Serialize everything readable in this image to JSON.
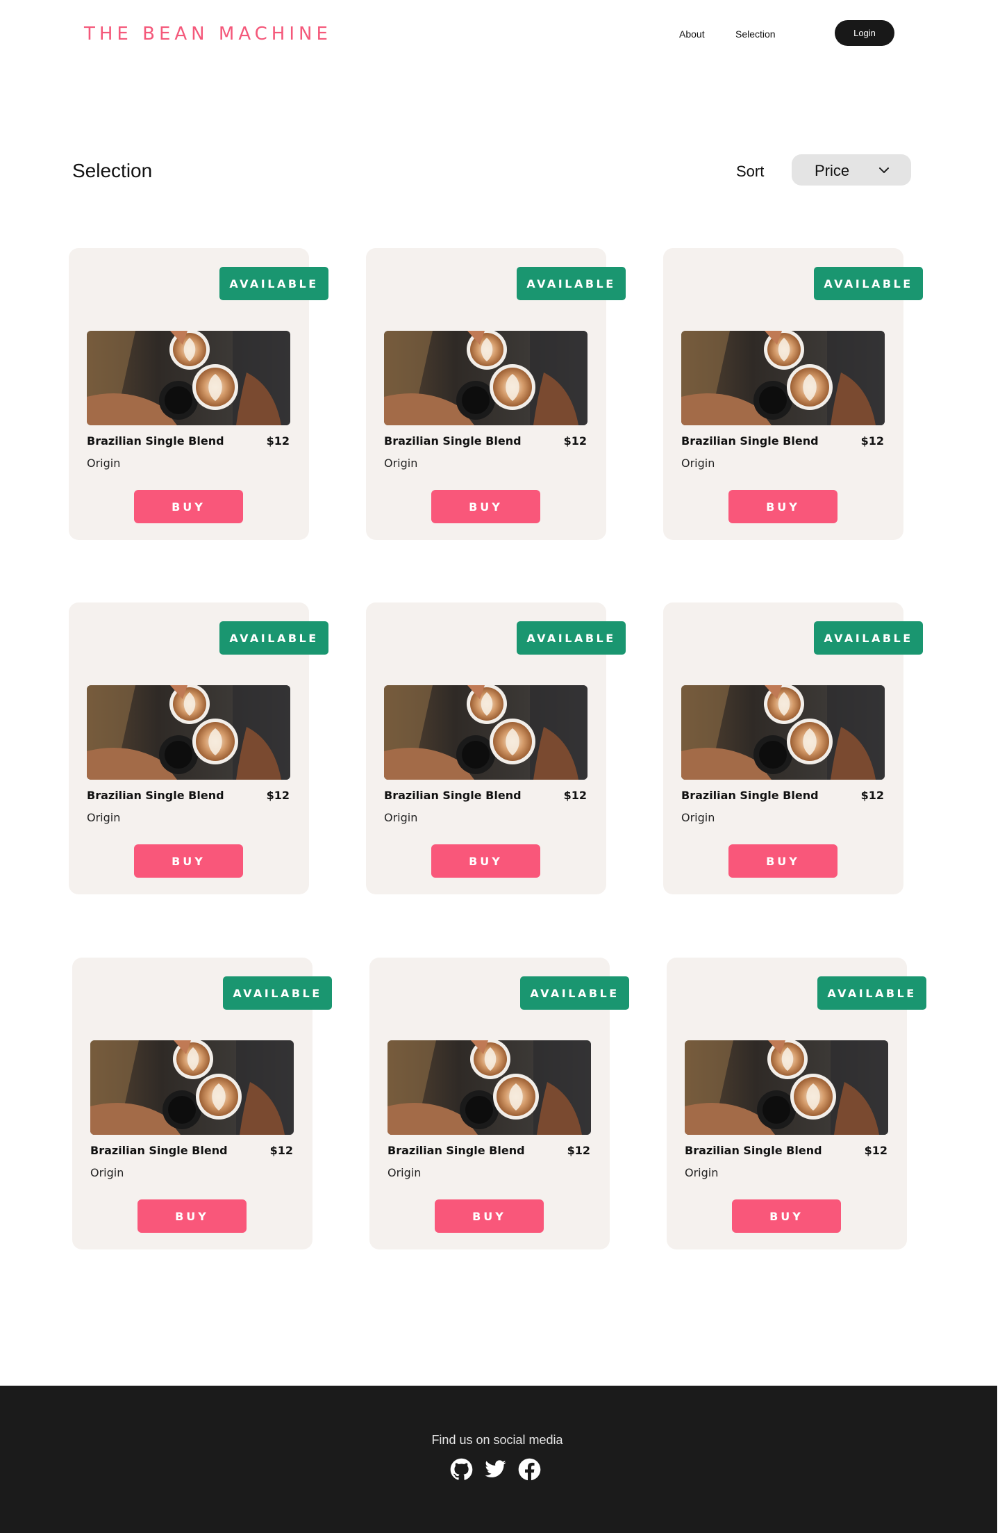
{
  "header": {
    "logo": "THE BEAN MACHINE",
    "nav": {
      "about": "About",
      "selection": "Selection"
    },
    "login_label": "Login"
  },
  "main": {
    "title": "Selection",
    "sort_label": "Sort",
    "sort_value": "Price"
  },
  "products": [
    {
      "status": "AVAILABLE",
      "name": "Brazilian Single Blend",
      "price": "$12",
      "origin": "Origin",
      "buy_label": "BUY"
    },
    {
      "status": "AVAILABLE",
      "name": "Brazilian Single Blend",
      "price": "$12",
      "origin": "Origin",
      "buy_label": "BUY"
    },
    {
      "status": "AVAILABLE",
      "name": "Brazilian Single Blend",
      "price": "$12",
      "origin": "Origin",
      "buy_label": "BUY"
    },
    {
      "status": "AVAILABLE",
      "name": "Brazilian Single Blend",
      "price": "$12",
      "origin": "Origin",
      "buy_label": "BUY"
    },
    {
      "status": "AVAILABLE",
      "name": "Brazilian Single Blend",
      "price": "$12",
      "origin": "Origin",
      "buy_label": "BUY"
    },
    {
      "status": "AVAILABLE",
      "name": "Brazilian Single Blend",
      "price": "$12",
      "origin": "Origin",
      "buy_label": "BUY"
    },
    {
      "status": "AVAILABLE",
      "name": "Brazilian Single Blend",
      "price": "$12",
      "origin": "Origin",
      "buy_label": "BUY"
    },
    {
      "status": "AVAILABLE",
      "name": "Brazilian Single Blend",
      "price": "$12",
      "origin": "Origin",
      "buy_label": "BUY"
    },
    {
      "status": "AVAILABLE",
      "name": "Brazilian Single Blend",
      "price": "$12",
      "origin": "Origin",
      "buy_label": "BUY"
    }
  ],
  "footer": {
    "text": "Find us on social media",
    "icons": [
      "github-icon",
      "twitter-icon",
      "facebook-icon"
    ]
  },
  "colors": {
    "brand": "#f4587a",
    "available": "#1a9670",
    "buy": "#f9577a",
    "card_bg": "#f5f1ee",
    "footer_bg": "#1b1b1b"
  }
}
